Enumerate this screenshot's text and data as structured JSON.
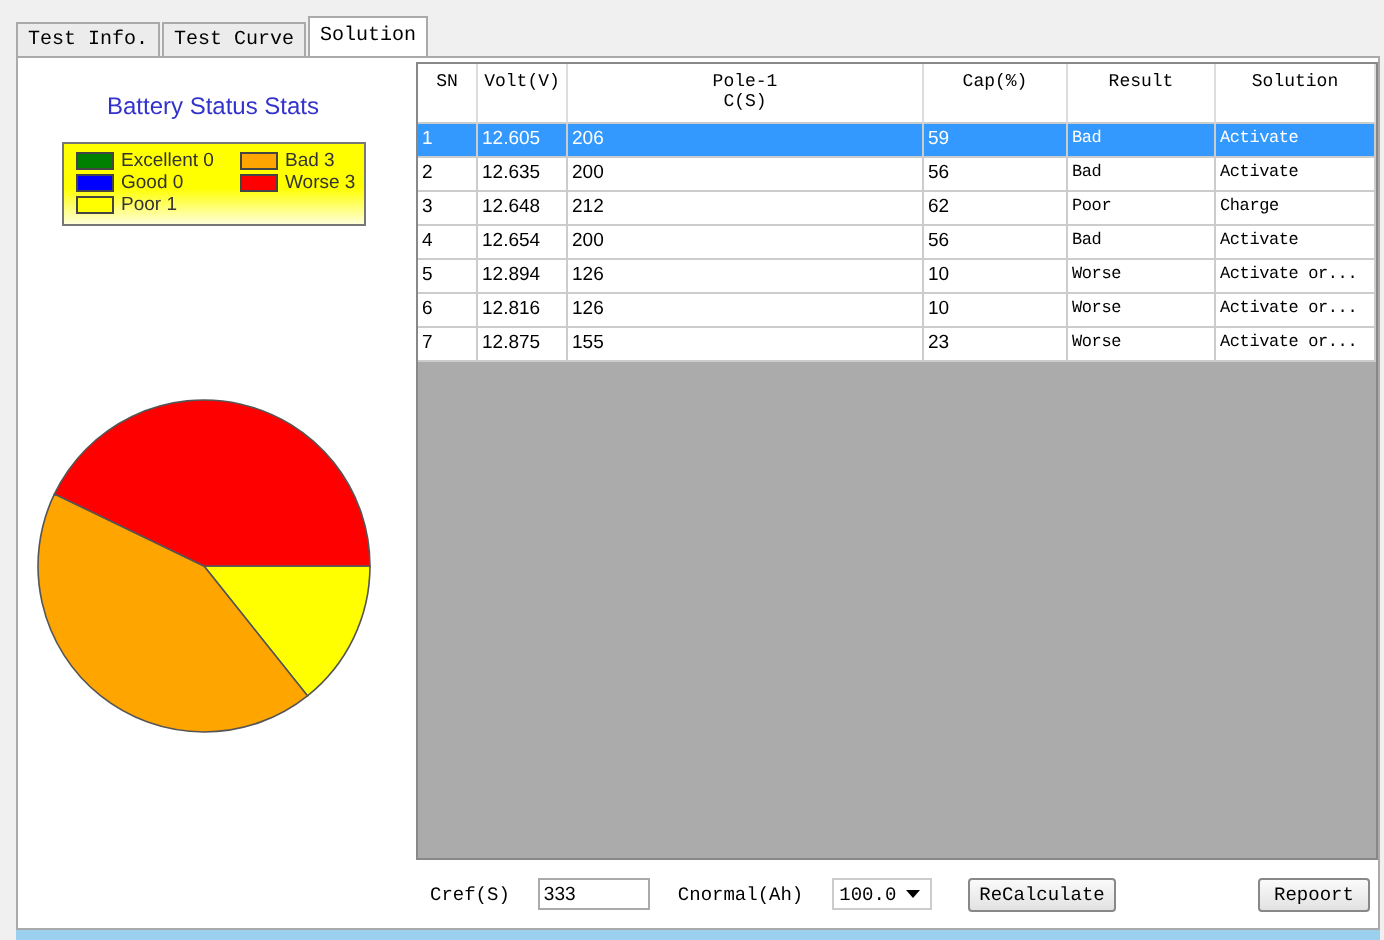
{
  "tabs": [
    {
      "label": "Test Info.",
      "selected": false
    },
    {
      "label": "Test Curve",
      "selected": false
    },
    {
      "label": "Solution",
      "selected": true
    }
  ],
  "stats": {
    "title": "Battery Status Stats",
    "legend": [
      {
        "label": "Excellent 0",
        "color": "#008000"
      },
      {
        "label": "Bad 3",
        "color": "#ffa500"
      },
      {
        "label": "Good 0",
        "color": "#0000ff"
      },
      {
        "label": "Worse 3",
        "color": "#ff0000"
      },
      {
        "label": "Poor 1",
        "color": "#ffff00"
      }
    ],
    "chart_data": {
      "type": "pie",
      "values": [
        14.29,
        42.86,
        42.85
      ],
      "colors": [
        "#ffff00",
        "#ffa500",
        "#ff0000"
      ]
    }
  },
  "table": {
    "columns": [
      "SN",
      "Volt(V)",
      "Pole-1\nC(S)",
      "Cap(%)",
      "Result",
      "Solution"
    ],
    "rows": [
      {
        "cells": [
          "1",
          "12.605",
          "206",
          "59",
          "Bad",
          "Activate"
        ],
        "selected": true
      },
      {
        "cells": [
          "2",
          "12.635",
          "200",
          "56",
          "Bad",
          "Activate"
        ],
        "selected": false
      },
      {
        "cells": [
          "3",
          "12.648",
          "212",
          "62",
          "Poor",
          "Charge"
        ],
        "selected": false
      },
      {
        "cells": [
          "4",
          "12.654",
          "200",
          "56",
          "Bad",
          "Activate"
        ],
        "selected": false
      },
      {
        "cells": [
          "5",
          "12.894",
          "126",
          "10",
          "Worse",
          "Activate or..."
        ],
        "selected": false
      },
      {
        "cells": [
          "6",
          "12.816",
          "126",
          "10",
          "Worse",
          "Activate or..."
        ],
        "selected": false
      },
      {
        "cells": [
          "7",
          "12.875",
          "155",
          "23",
          "Worse",
          "Activate or..."
        ],
        "selected": false
      }
    ]
  },
  "bottom": {
    "cref_label": "Cref(S)",
    "cref_value": "333",
    "cnormal_label": "Cnormal(Ah)",
    "cnormal_value": "100.0",
    "recalculate": "ReCalculate",
    "report": "Repoort"
  }
}
